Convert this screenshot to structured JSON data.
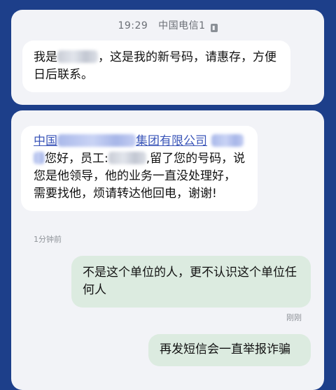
{
  "status_bar": {
    "time": "19:29",
    "carrier": "中国电信1"
  },
  "top_message": {
    "prefix": "我是",
    "text_after_name": "，这是我的新号码，请惠存，方便日后联系。"
  },
  "sms": {
    "company_prefix": "中国",
    "company_suffix": "集团有限公司",
    "greeting": "您好，员工:",
    "body": ",留了您的号码，说您是他领导，他的业务一直没处理好，需要找他，烦请转达他回电，谢谢!",
    "time": "1分钟前"
  },
  "replies": [
    {
      "text": "不是这个单位的人，更不认识这个单位任何人",
      "time": "刚刚"
    },
    {
      "text": "再发短信会一直举报诈骗"
    }
  ]
}
